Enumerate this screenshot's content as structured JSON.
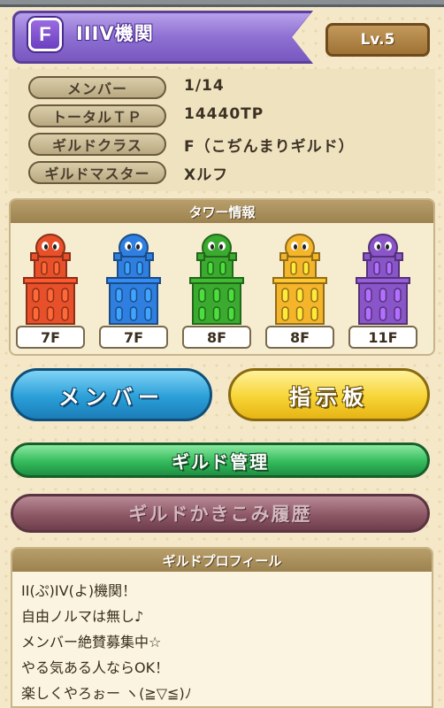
{
  "header": {
    "class_letter": "F",
    "guild_name": "IIIV機関",
    "level": "Lv.5",
    "banner_color": "#8e6fd2"
  },
  "info": [
    {
      "label": "メンバー",
      "value": "1/14"
    },
    {
      "label": "トータルＴＰ",
      "value": "14440TP"
    },
    {
      "label": "ギルドクラス",
      "value": "F（こぢんまりギルド）"
    },
    {
      "label": "ギルドマスター",
      "value": "Xルフ"
    }
  ],
  "tower_section": {
    "title": "タワー情報",
    "towers": [
      {
        "color": "red",
        "hex": "#e8502a",
        "floor": "7F"
      },
      {
        "color": "blue",
        "hex": "#2f7fe0",
        "floor": "7F"
      },
      {
        "color": "green",
        "hex": "#3aab2e",
        "floor": "8F"
      },
      {
        "color": "yellow",
        "hex": "#f4b52a",
        "floor": "8F"
      },
      {
        "color": "purple",
        "hex": "#8a55c8",
        "floor": "11F"
      }
    ]
  },
  "buttons": {
    "member": "メンバー",
    "board": "指示板",
    "manage": "ギルド管理",
    "history": "ギルドかきこみ履歴"
  },
  "profile": {
    "title": "ギルドプロフィール",
    "lines": [
      "II(ぷ)IV(よ)機関！",
      "自由ノルマは無し♪",
      "メンバー絶賛募集中☆",
      "やる気ある人ならOK！",
      "楽しくやろぉー ヽ(≧▽≦)ﾉ"
    ]
  }
}
